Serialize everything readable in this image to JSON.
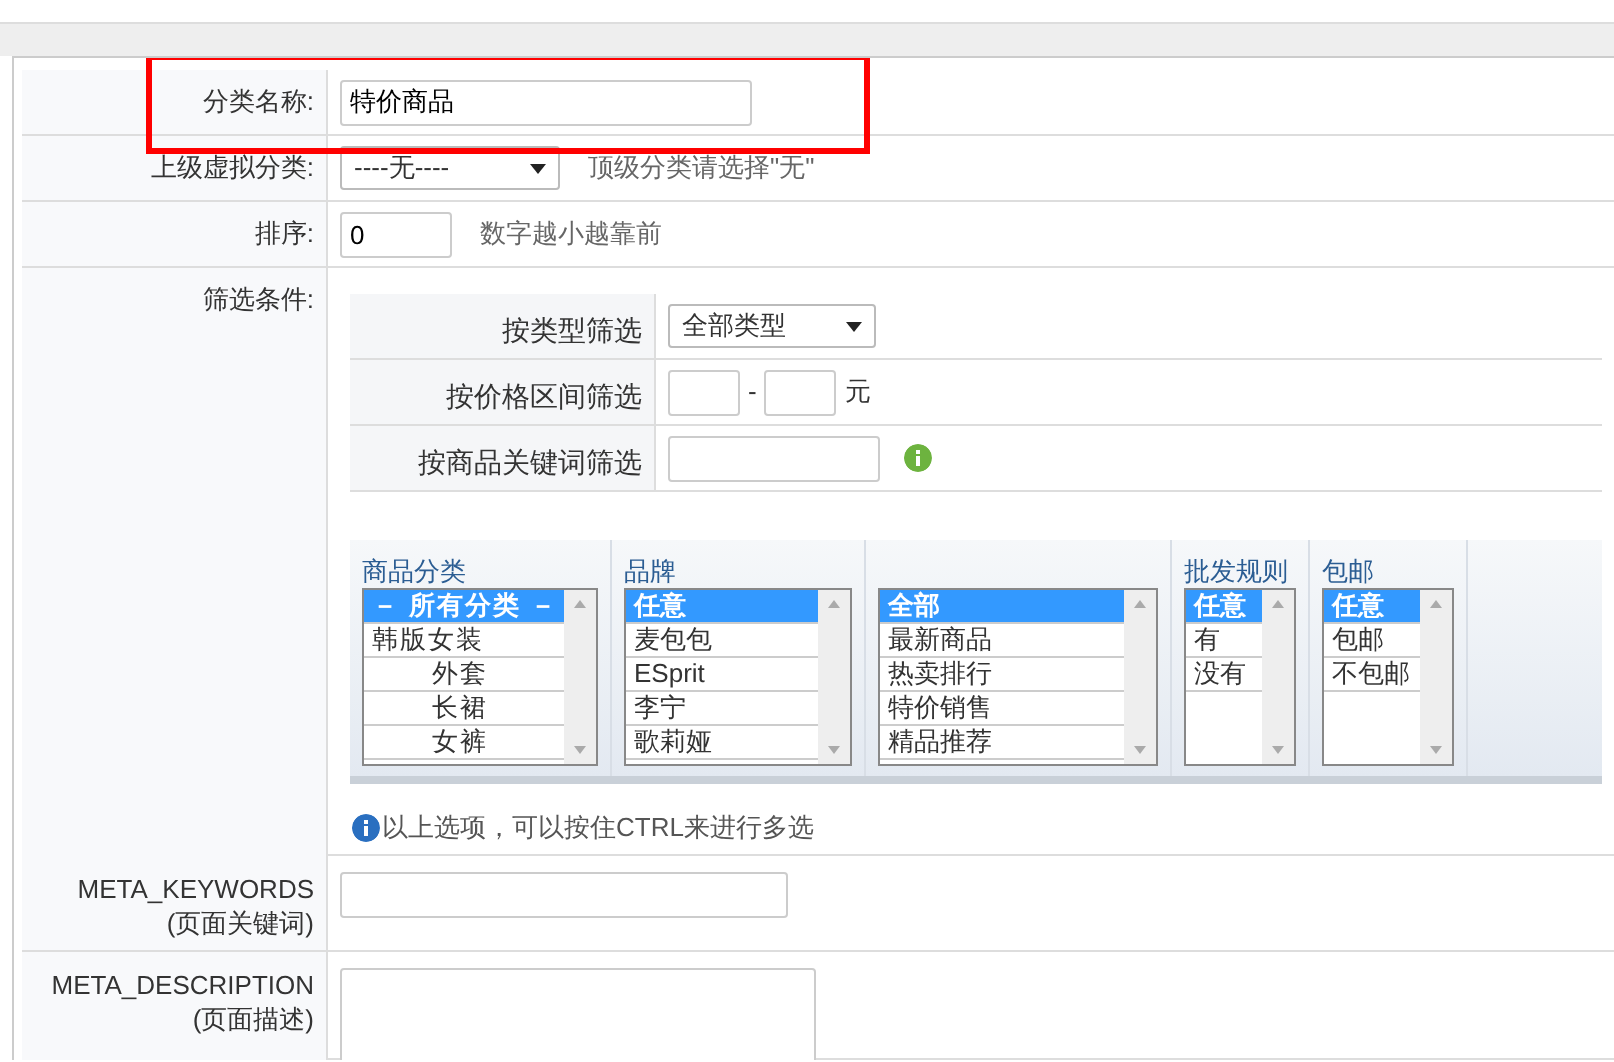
{
  "form": {
    "name": {
      "label": "分类名称:",
      "value": "特价商品",
      "highlighted": true
    },
    "parent": {
      "label": "上级虚拟分类:",
      "value": "----无----",
      "hint": "顶级分类请选择\"无\""
    },
    "sort": {
      "label": "排序:",
      "value": "0",
      "hint": "数字越小越靠前"
    },
    "filter": {
      "label": "筛选条件:",
      "type_filter": {
        "label": "按类型筛选",
        "value": "全部类型"
      },
      "price_filter": {
        "label": "按价格区间筛选",
        "separator": "-",
        "unit": "元"
      },
      "keyword_filter": {
        "label": "按商品关键词筛选"
      },
      "lists": [
        {
          "title": "商品分类",
          "items": [
            {
              "label": "－ 所有分类 －",
              "selected": true
            },
            {
              "label": "韩版女装",
              "selected": false,
              "children": [
                {
                  "label": "外套",
                  "selected": false
                },
                {
                  "label": "长裙",
                  "selected": false
                },
                {
                  "label": "女裤",
                  "selected": false
                }
              ]
            }
          ]
        },
        {
          "title": "品牌",
          "items": [
            {
              "label": "任意",
              "selected": true
            },
            {
              "label": "麦包包",
              "selected": false
            },
            {
              "label": "ESprit",
              "selected": false
            },
            {
              "label": "李宁",
              "selected": false
            },
            {
              "label": "歌莉娅",
              "selected": false
            }
          ]
        },
        {
          "items": [
            {
              "label": "全部",
              "selected": true
            },
            {
              "label": "最新商品",
              "selected": false
            },
            {
              "label": "热卖排行",
              "selected": false
            },
            {
              "label": "特价销售",
              "selected": false
            },
            {
              "label": "精品推荐",
              "selected": false
            }
          ]
        },
        {
          "title": "批发规则",
          "items": [
            {
              "label": "任意",
              "selected": true
            },
            {
              "label": "有",
              "selected": false
            },
            {
              "label": "没有",
              "selected": false
            }
          ]
        },
        {
          "title": "包邮",
          "items": [
            {
              "label": "任意",
              "selected": true
            },
            {
              "label": "包邮",
              "selected": false
            },
            {
              "label": "不包邮",
              "selected": false
            }
          ]
        }
      ],
      "note": "以上选项，可以按住CTRL来进行多选"
    },
    "meta_keywords": {
      "label": "META_KEYWORDS",
      "sublabel": "(页面关键词)"
    },
    "meta_description": {
      "label": "META_DESCRIPTION",
      "sublabel": "(页面描述)"
    }
  }
}
